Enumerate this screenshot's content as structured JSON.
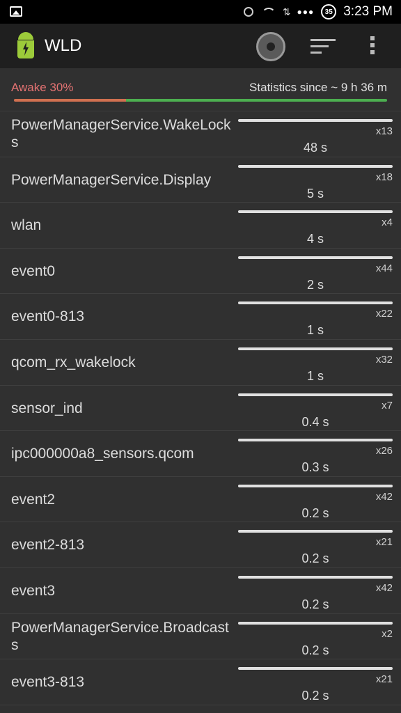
{
  "status_bar": {
    "time": "3:23",
    "ampm": "PM",
    "battery": "35"
  },
  "toolbar": {
    "title": "WLD"
  },
  "summary": {
    "awake_label": "Awake 30%",
    "awake_fraction": 0.3,
    "stats_label": "Statistics since ~ 9 h 36 m",
    "colors": {
      "awake": "#d07050",
      "asleep": "#4caf50"
    }
  },
  "wakelocks": [
    {
      "name": "PowerManagerService.WakeLocks",
      "count": "x13",
      "duration": "48 s"
    },
    {
      "name": "PowerManagerService.Display",
      "count": "x18",
      "duration": "5 s"
    },
    {
      "name": "wlan",
      "count": "x4",
      "duration": "4 s"
    },
    {
      "name": "event0",
      "count": "x44",
      "duration": "2 s"
    },
    {
      "name": "event0-813",
      "count": "x22",
      "duration": "1 s"
    },
    {
      "name": "qcom_rx_wakelock",
      "count": "x32",
      "duration": "1 s"
    },
    {
      "name": "sensor_ind",
      "count": "x7",
      "duration": "0.4 s"
    },
    {
      "name": "ipc000000a8_sensors.qcom",
      "count": "x26",
      "duration": "0.3 s"
    },
    {
      "name": "event2",
      "count": "x42",
      "duration": "0.2 s"
    },
    {
      "name": "event2-813",
      "count": "x21",
      "duration": "0.2 s"
    },
    {
      "name": "event3",
      "count": "x42",
      "duration": "0.2 s"
    },
    {
      "name": "PowerManagerService.Broadcasts",
      "count": "x2",
      "duration": "0.2 s"
    },
    {
      "name": "event3-813",
      "count": "x21",
      "duration": "0.2 s"
    }
  ]
}
